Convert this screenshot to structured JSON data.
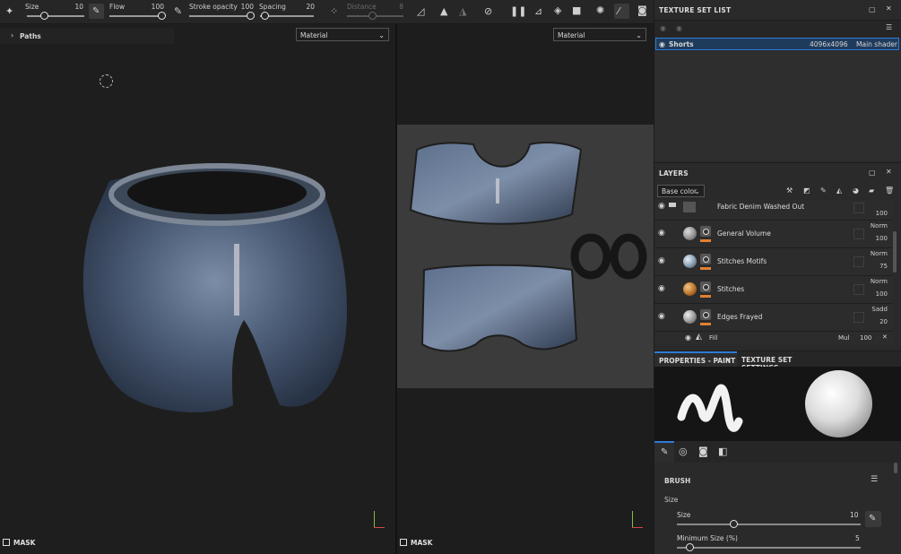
{
  "toolbar": {
    "size_label": "Size",
    "size_value": "10",
    "flow_label": "Flow",
    "flow_value": "100",
    "stroke_opacity_label": "Stroke opacity",
    "stroke_opacity_value": "100",
    "spacing_label": "Spacing",
    "spacing_value": "20",
    "distance_label": "Distance",
    "distance_value": "8"
  },
  "viewport3d": {
    "paths_label": "Paths",
    "channel_select": "Material",
    "mask_label": "MASK"
  },
  "viewport2d": {
    "channel_select": "Material",
    "mask_label": "MASK"
  },
  "texture_set_list": {
    "title": "TEXTURE SET LIST",
    "row": {
      "name": "Shorts",
      "resolution": "4096x4096",
      "shader": "Main shader"
    }
  },
  "layers": {
    "title": "LAYERS",
    "channel_select": "Base color",
    "items": [
      {
        "name": "Fabric Denim Washed Out",
        "blend": "",
        "opacity": "100",
        "sphere": "#6b6b6b"
      },
      {
        "name": "General Volume",
        "blend": "Norm",
        "opacity": "100",
        "sphere": "#9a9a9a"
      },
      {
        "name": "Stitches Motifs",
        "blend": "Norm",
        "opacity": "75",
        "sphere": "#8fa4b8"
      },
      {
        "name": "Stitches",
        "blend": "Norm",
        "opacity": "100",
        "sphere": "#c27a2e"
      },
      {
        "name": "Edges Frayed",
        "blend": "Sadd",
        "opacity": "20",
        "sphere": "#a0a0a0"
      }
    ],
    "fill": {
      "name": "Fill",
      "blend": "Mul",
      "opacity": "100"
    }
  },
  "properties": {
    "tab_paint": "PROPERTIES - PAINT",
    "tab_tss": "TEXTURE SET SETTINGS",
    "brush_title": "BRUSH",
    "size_section": "Size",
    "size_label": "Size",
    "size_value": "10",
    "min_size_label": "Minimum Size (%)",
    "min_size_value": "5"
  },
  "colors": {
    "accent_blue": "#2e7bd6",
    "orange": "#e2802f",
    "selection": "#1f3b5c"
  }
}
